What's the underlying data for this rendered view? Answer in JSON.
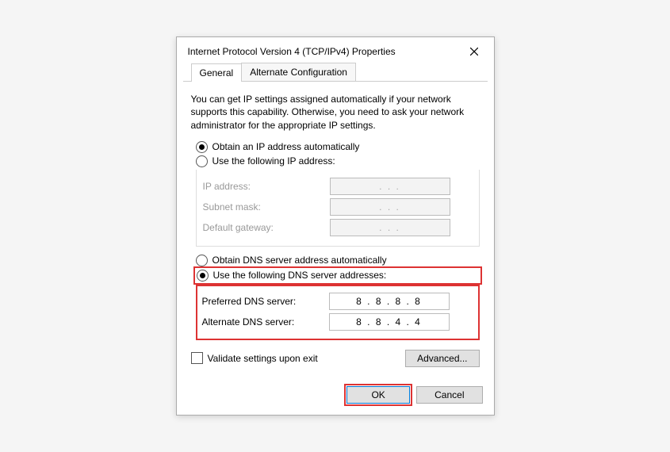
{
  "window": {
    "title": "Internet Protocol Version 4 (TCP/IPv4) Properties"
  },
  "tabs": {
    "general": "General",
    "alternate": "Alternate Configuration"
  },
  "description": "You can get IP settings assigned automatically if your network supports this capability. Otherwise, you need to ask your network administrator for the appropriate IP settings.",
  "ip_section": {
    "auto_label": "Obtain an IP address automatically",
    "manual_label": "Use the following IP address:",
    "ip_label": "IP address:",
    "subnet_label": "Subnet mask:",
    "gateway_label": "Default gateway:",
    "ip_value": ".       .       .",
    "subnet_value": ".       .       .",
    "gateway_value": ".       .       ."
  },
  "dns_section": {
    "auto_label": "Obtain DNS server address automatically",
    "manual_label": "Use the following DNS server addresses:",
    "preferred_label": "Preferred DNS server:",
    "alternate_label": "Alternate DNS server:",
    "preferred_value": "8  .  8  .  8  .  8",
    "alternate_value": "8  .  8  .  4  .  4"
  },
  "validate_label": "Validate settings upon exit",
  "advanced_label": "Advanced...",
  "buttons": {
    "ok": "OK",
    "cancel": "Cancel"
  }
}
